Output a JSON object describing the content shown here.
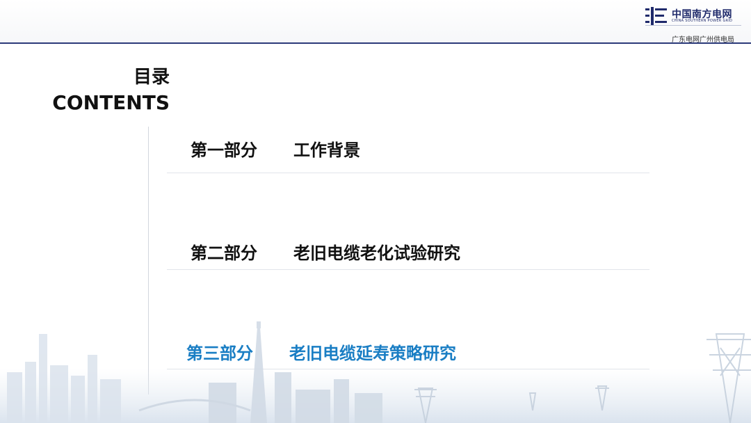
{
  "header": {
    "logo": {
      "name_cn": "中国南方电网",
      "name_en": "CHINA SOUTHERN POWER GRID",
      "subtitle": "广东电网广州供电局",
      "icon": "csg-logo-icon"
    }
  },
  "toc": {
    "title_cn": "目录",
    "title_en": "CONTENTS",
    "items": [
      {
        "part": "第一部分",
        "title": "工作背景",
        "active": false
      },
      {
        "part": "第二部分",
        "title": "老旧电缆老化试验研究",
        "active": false
      },
      {
        "part": "第三部分",
        "title": "老旧电缆延寿策略研究",
        "active": true
      }
    ]
  },
  "colors": {
    "accent": "#1a7ec4",
    "header_rule": "#2b3a7a",
    "text": "#111111"
  }
}
